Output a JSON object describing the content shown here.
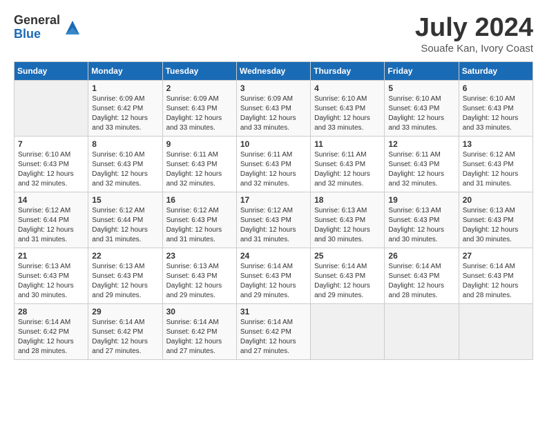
{
  "header": {
    "logo_general": "General",
    "logo_blue": "Blue",
    "month_title": "July 2024",
    "location": "Souafe Kan, Ivory Coast"
  },
  "days_of_week": [
    "Sunday",
    "Monday",
    "Tuesday",
    "Wednesday",
    "Thursday",
    "Friday",
    "Saturday"
  ],
  "weeks": [
    [
      {
        "day": "",
        "info": ""
      },
      {
        "day": "1",
        "info": "Sunrise: 6:09 AM\nSunset: 6:42 PM\nDaylight: 12 hours\nand 33 minutes."
      },
      {
        "day": "2",
        "info": "Sunrise: 6:09 AM\nSunset: 6:43 PM\nDaylight: 12 hours\nand 33 minutes."
      },
      {
        "day": "3",
        "info": "Sunrise: 6:09 AM\nSunset: 6:43 PM\nDaylight: 12 hours\nand 33 minutes."
      },
      {
        "day": "4",
        "info": "Sunrise: 6:10 AM\nSunset: 6:43 PM\nDaylight: 12 hours\nand 33 minutes."
      },
      {
        "day": "5",
        "info": "Sunrise: 6:10 AM\nSunset: 6:43 PM\nDaylight: 12 hours\nand 33 minutes."
      },
      {
        "day": "6",
        "info": "Sunrise: 6:10 AM\nSunset: 6:43 PM\nDaylight: 12 hours\nand 33 minutes."
      }
    ],
    [
      {
        "day": "7",
        "info": "Sunrise: 6:10 AM\nSunset: 6:43 PM\nDaylight: 12 hours\nand 32 minutes."
      },
      {
        "day": "8",
        "info": "Sunrise: 6:10 AM\nSunset: 6:43 PM\nDaylight: 12 hours\nand 32 minutes."
      },
      {
        "day": "9",
        "info": "Sunrise: 6:11 AM\nSunset: 6:43 PM\nDaylight: 12 hours\nand 32 minutes."
      },
      {
        "day": "10",
        "info": "Sunrise: 6:11 AM\nSunset: 6:43 PM\nDaylight: 12 hours\nand 32 minutes."
      },
      {
        "day": "11",
        "info": "Sunrise: 6:11 AM\nSunset: 6:43 PM\nDaylight: 12 hours\nand 32 minutes."
      },
      {
        "day": "12",
        "info": "Sunrise: 6:11 AM\nSunset: 6:43 PM\nDaylight: 12 hours\nand 32 minutes."
      },
      {
        "day": "13",
        "info": "Sunrise: 6:12 AM\nSunset: 6:43 PM\nDaylight: 12 hours\nand 31 minutes."
      }
    ],
    [
      {
        "day": "14",
        "info": "Sunrise: 6:12 AM\nSunset: 6:44 PM\nDaylight: 12 hours\nand 31 minutes."
      },
      {
        "day": "15",
        "info": "Sunrise: 6:12 AM\nSunset: 6:44 PM\nDaylight: 12 hours\nand 31 minutes."
      },
      {
        "day": "16",
        "info": "Sunrise: 6:12 AM\nSunset: 6:43 PM\nDaylight: 12 hours\nand 31 minutes."
      },
      {
        "day": "17",
        "info": "Sunrise: 6:12 AM\nSunset: 6:43 PM\nDaylight: 12 hours\nand 31 minutes."
      },
      {
        "day": "18",
        "info": "Sunrise: 6:13 AM\nSunset: 6:43 PM\nDaylight: 12 hours\nand 30 minutes."
      },
      {
        "day": "19",
        "info": "Sunrise: 6:13 AM\nSunset: 6:43 PM\nDaylight: 12 hours\nand 30 minutes."
      },
      {
        "day": "20",
        "info": "Sunrise: 6:13 AM\nSunset: 6:43 PM\nDaylight: 12 hours\nand 30 minutes."
      }
    ],
    [
      {
        "day": "21",
        "info": "Sunrise: 6:13 AM\nSunset: 6:43 PM\nDaylight: 12 hours\nand 30 minutes."
      },
      {
        "day": "22",
        "info": "Sunrise: 6:13 AM\nSunset: 6:43 PM\nDaylight: 12 hours\nand 29 minutes."
      },
      {
        "day": "23",
        "info": "Sunrise: 6:13 AM\nSunset: 6:43 PM\nDaylight: 12 hours\nand 29 minutes."
      },
      {
        "day": "24",
        "info": "Sunrise: 6:14 AM\nSunset: 6:43 PM\nDaylight: 12 hours\nand 29 minutes."
      },
      {
        "day": "25",
        "info": "Sunrise: 6:14 AM\nSunset: 6:43 PM\nDaylight: 12 hours\nand 29 minutes."
      },
      {
        "day": "26",
        "info": "Sunrise: 6:14 AM\nSunset: 6:43 PM\nDaylight: 12 hours\nand 28 minutes."
      },
      {
        "day": "27",
        "info": "Sunrise: 6:14 AM\nSunset: 6:43 PM\nDaylight: 12 hours\nand 28 minutes."
      }
    ],
    [
      {
        "day": "28",
        "info": "Sunrise: 6:14 AM\nSunset: 6:42 PM\nDaylight: 12 hours\nand 28 minutes."
      },
      {
        "day": "29",
        "info": "Sunrise: 6:14 AM\nSunset: 6:42 PM\nDaylight: 12 hours\nand 27 minutes."
      },
      {
        "day": "30",
        "info": "Sunrise: 6:14 AM\nSunset: 6:42 PM\nDaylight: 12 hours\nand 27 minutes."
      },
      {
        "day": "31",
        "info": "Sunrise: 6:14 AM\nSunset: 6:42 PM\nDaylight: 12 hours\nand 27 minutes."
      },
      {
        "day": "",
        "info": ""
      },
      {
        "day": "",
        "info": ""
      },
      {
        "day": "",
        "info": ""
      }
    ]
  ]
}
